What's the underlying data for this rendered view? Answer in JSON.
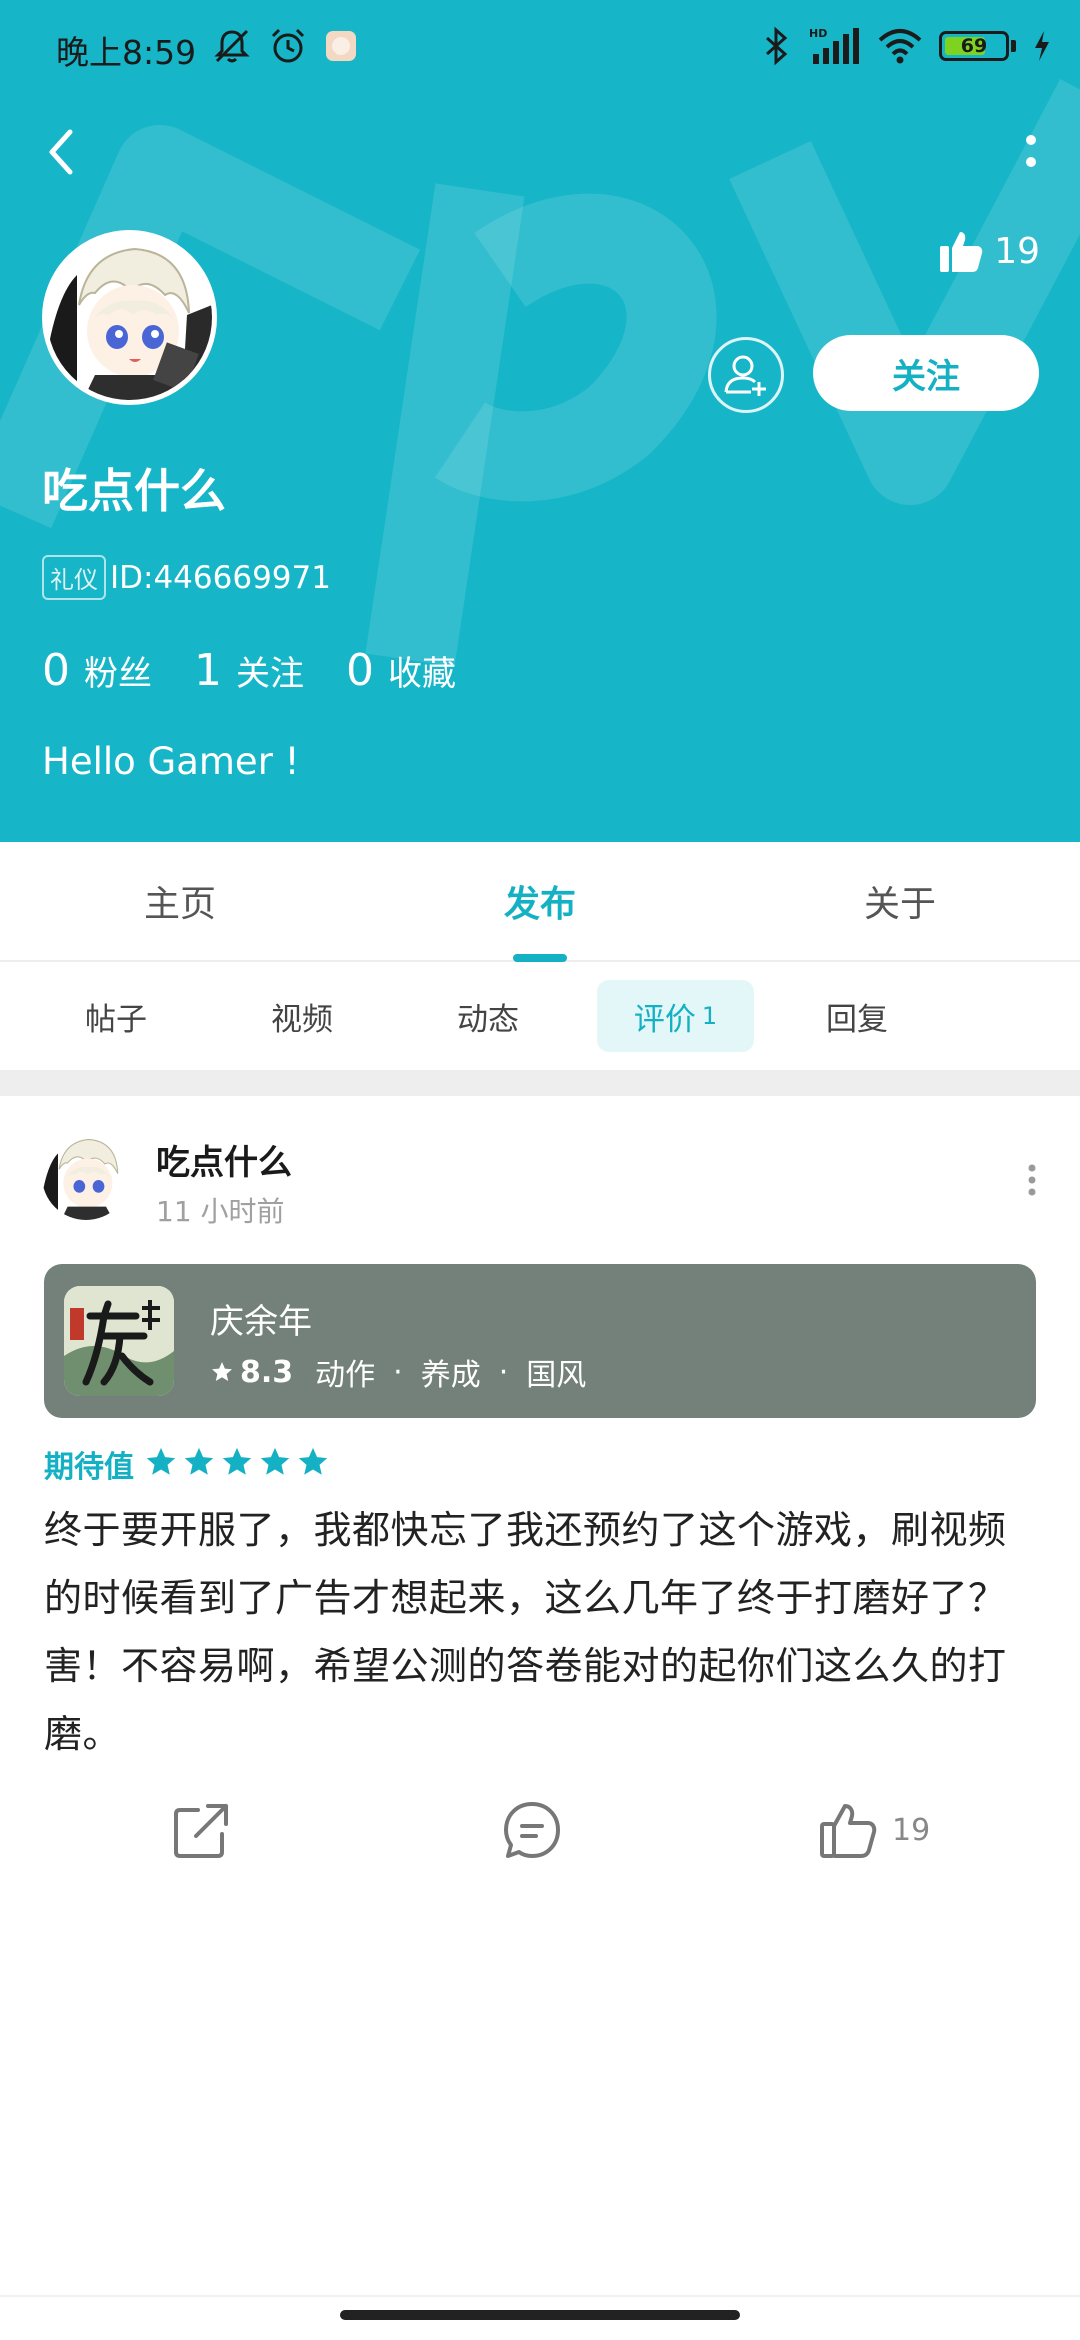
{
  "status_bar": {
    "time": "晚上8:59",
    "battery": "69",
    "battery_level": 0.69,
    "icons": [
      "mute-icon",
      "alarm-icon",
      "app-icon",
      "bluetooth-icon",
      "signal-icon",
      "wifi-icon",
      "battery-icon",
      "charging-icon"
    ]
  },
  "profile": {
    "like_count": "19",
    "follow_button": "关注",
    "username": "吃点什么",
    "id_badge": "礼仪",
    "id_text": "ID:446669971",
    "stats": [
      {
        "num": "0",
        "label": "粉丝"
      },
      {
        "num": "1",
        "label": "关注"
      },
      {
        "num": "0",
        "label": "收藏"
      }
    ],
    "bio": "Hello Gamer !"
  },
  "main_tabs": [
    {
      "label": "主页"
    },
    {
      "label": "发布"
    },
    {
      "label": "关于"
    }
  ],
  "sub_tabs": [
    {
      "label": "帖子"
    },
    {
      "label": "视频"
    },
    {
      "label": "动态"
    },
    {
      "label": "评价",
      "count": "1"
    },
    {
      "label": "回复"
    }
  ],
  "post": {
    "author": "吃点什么",
    "time": "11 小时前",
    "game": {
      "name": "庆余年",
      "score": "8.3",
      "tags": [
        "动作",
        "养成",
        "国风"
      ]
    },
    "expect_label": "期待值",
    "rating": 5,
    "body": "终于要开服了，我都快忘了我还预约了这个游戏，刷视频的时候看到了广告才想起来，这么几年了终于打磨好了？害！不容易啊，希望公测的答卷能对的起你们这么久的打磨。",
    "like_count": "19"
  },
  "colors": {
    "accent": "#14b1c4",
    "header_bg": "#16b6c8",
    "game_card_bg": "#74817a"
  }
}
